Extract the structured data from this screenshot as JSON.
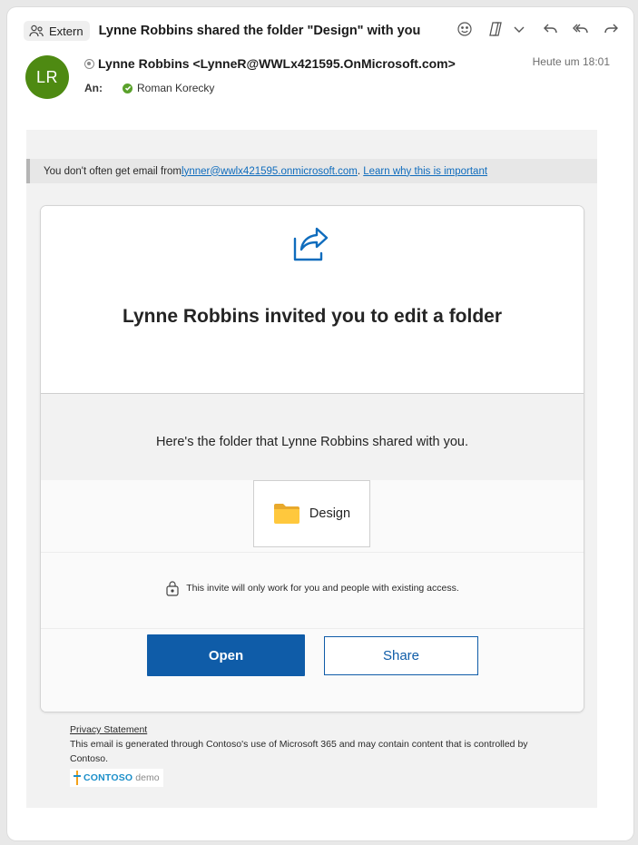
{
  "header": {
    "extern_label": "Extern",
    "subject": "Lynne Robbins shared the folder \"Design\" with you",
    "avatar_initials": "LR",
    "sender": "Lynne Robbins <LynneR@WWLx421595.OnMicrosoft.com>",
    "date": "Heute um 18:01",
    "to_label": "An:",
    "recipient": "Roman Korecky",
    "icons": [
      "emoji-icon",
      "copilot-icon",
      "chevron-down-icon",
      "reply-icon",
      "reply-all-icon",
      "forward-icon"
    ]
  },
  "notice": {
    "prefix": "You don't often get email from ",
    "email": "lynner@wwlx421595.onmicrosoft.com",
    "separator": ". ",
    "learn_link": "Learn why this is important"
  },
  "card": {
    "title": "Lynne Robbins invited you to edit a folder",
    "shared_text": "Here's the folder that Lynne Robbins shared with you.",
    "file_name": "Design",
    "invite_note": "This invite will only work for you and people with existing access.",
    "open_label": "Open",
    "share_label": "Share"
  },
  "footer": {
    "privacy": "Privacy Statement",
    "disclaimer": "This email is generated through Contoso's use of Microsoft 365 and may contain content that is controlled by Contoso.",
    "logo_brand": "CONTOSO",
    "logo_suffix": "demo"
  },
  "colors": {
    "avatar": "#4e8a12",
    "primary_button": "#0f5ca8",
    "link": "#0f6cbd",
    "folder": "#ffc83d"
  }
}
